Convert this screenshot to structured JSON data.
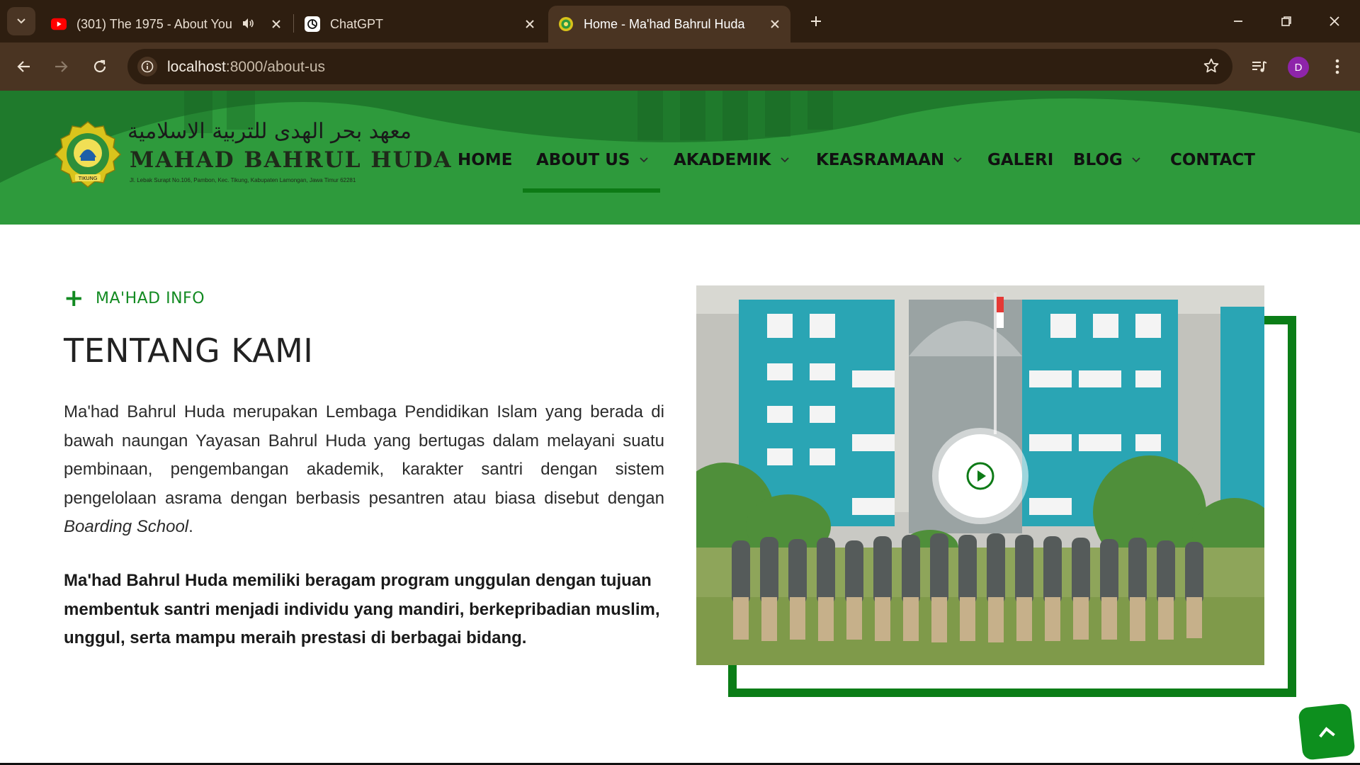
{
  "browser": {
    "tabs": [
      {
        "title": "(301) The 1975 - About You",
        "favicon": "youtube-icon",
        "audio": true
      },
      {
        "title": "ChatGPT",
        "favicon": "chatgpt-icon"
      },
      {
        "title": "Home - Ma'had Bahrul Huda",
        "favicon": "mahad-logo-icon",
        "active": true
      }
    ],
    "url_host": "localhost",
    "url_path": ":8000/about-us",
    "profile_initial": "D"
  },
  "site": {
    "brand_arabic": "معهد بحر الهدى للتربية الاسلامية",
    "brand_name": "MAHAD BAHRUL HUDA",
    "brand_address": "Jl. Lebak Surapt No.106, Pambon, Kec. Tikung, Kabupaten Lamongan, Jawa Timur 62281",
    "logo_label": "TIKUNG",
    "nav": [
      {
        "label": "HOME",
        "dropdown": false
      },
      {
        "label": "ABOUT US",
        "dropdown": true,
        "active": true
      },
      {
        "label": "AKADEMIK",
        "dropdown": true
      },
      {
        "label": "KEASRAMAAN",
        "dropdown": true
      },
      {
        "label": "GALERI",
        "dropdown": false
      },
      {
        "label": "BLOG",
        "dropdown": true
      },
      {
        "label": "CONTACT",
        "dropdown": false
      }
    ]
  },
  "about": {
    "eyebrow": "MA'HAD INFO",
    "title": "TENTANG KAMI",
    "paragraph": "Ma'had Bahrul Huda merupakan Lembaga Pendidikan Islam yang berada di bawah naungan Yayasan Bahrul Huda yang bertugas dalam melayani suatu pembinaan, pengembangan akademik, karakter santri dengan sistem pengelolaan asrama dengan berbasis pesantren atau biasa disebut dengan",
    "paragraph_em": "Boarding School",
    "paragraph_end": ".",
    "highlight": "Ma'had Bahrul Huda memiliki beragam program unggulan dengan tujuan membentuk santri menjadi individu yang mandiri, berkepribadian muslim, unggul, serta mampu meraih prestasi di berbagai bidang."
  },
  "colors": {
    "brand_green": "#2e9a3c",
    "accent_green": "#0b7d17",
    "chrome_dark": "#2e1e10",
    "chrome_mid": "#4a3422"
  }
}
